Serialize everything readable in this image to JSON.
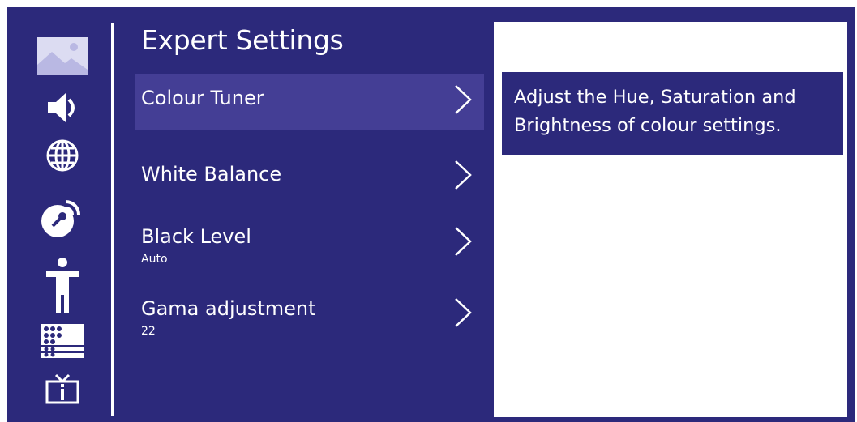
{
  "sidebar": {
    "icons": [
      {
        "name": "picture-icon",
        "selected": true
      },
      {
        "name": "speaker-icon"
      },
      {
        "name": "globe-icon"
      },
      {
        "name": "satellite-dish-icon"
      },
      {
        "name": "accessibility-person-icon"
      },
      {
        "name": "parental-lock-grid-icon"
      },
      {
        "name": "tv-info-icon"
      }
    ]
  },
  "menu": {
    "title": "Expert Settings",
    "items": [
      {
        "label": "Colour Tuner",
        "value": "",
        "selected": true
      },
      {
        "label": "White Balance",
        "value": ""
      },
      {
        "label": "Black Level",
        "value": "Auto"
      },
      {
        "label": "Gama adjustment",
        "value": "22"
      }
    ]
  },
  "description": {
    "text": "Adjust the Hue, Saturation and Brightness of colour settings."
  },
  "colors": {
    "background": "#2c297b",
    "selected_item": "#443e95",
    "text": "#ffffff"
  }
}
